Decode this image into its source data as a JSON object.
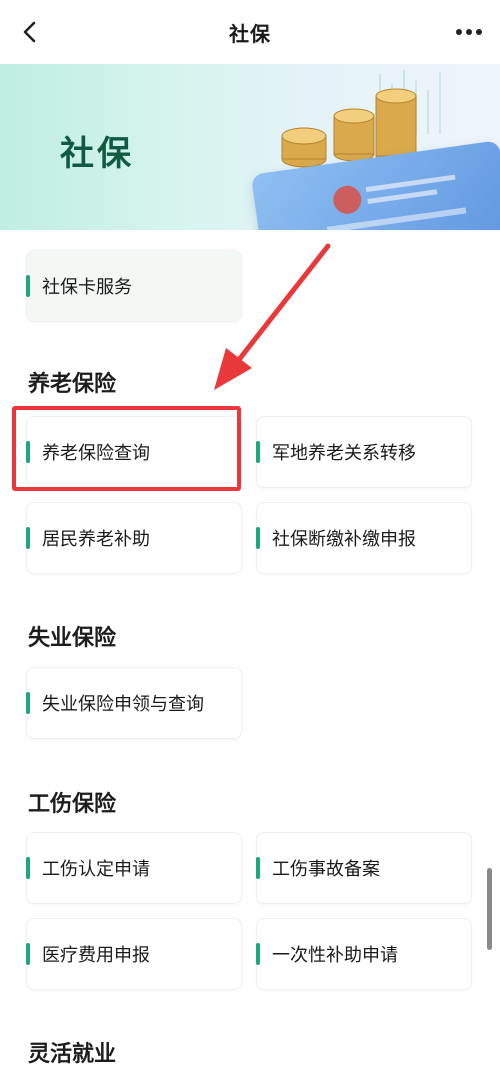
{
  "header": {
    "title": "社保"
  },
  "banner": {
    "title": "社保"
  },
  "top": {
    "card_service": "社保卡服务"
  },
  "pension": {
    "title": "养老保险",
    "items": [
      "养老保险查询",
      "军地养老关系转移",
      "居民养老补助",
      "社保断缴补缴申报"
    ]
  },
  "unemployment": {
    "title": "失业保险",
    "items": [
      "失业保险申领与查询"
    ]
  },
  "injury": {
    "title": "工伤保险",
    "items": [
      "工伤认定申请",
      "工伤事故备案",
      "医疗费用申报",
      "一次性补助申请"
    ]
  },
  "flexible": {
    "title": "灵活就业"
  },
  "colors": {
    "accent": "#1fa67a",
    "highlight": "#e8383a",
    "banner_title": "#0f5a40"
  }
}
